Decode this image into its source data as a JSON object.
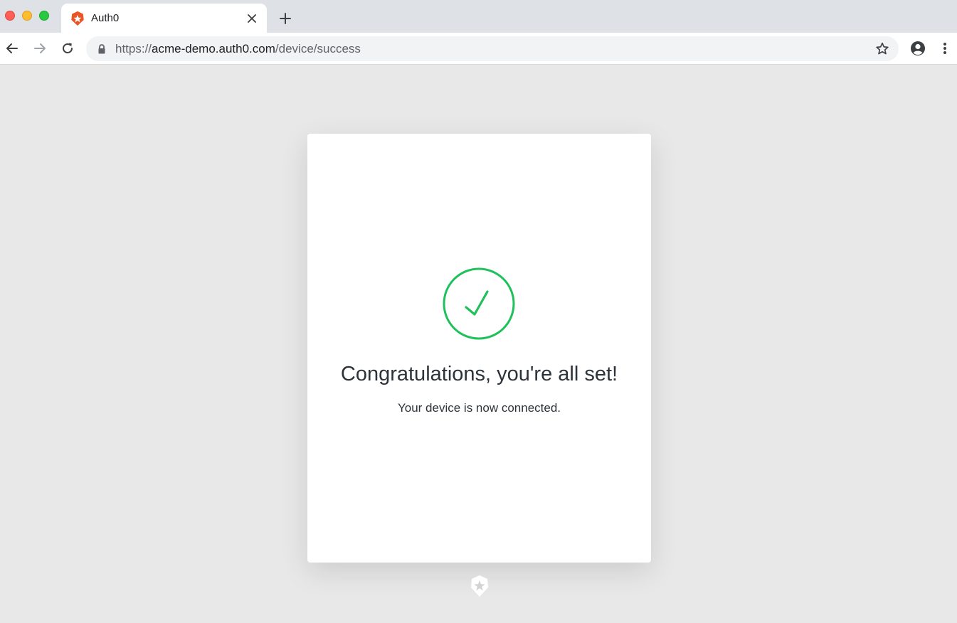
{
  "browser": {
    "tab": {
      "title": "Auth0"
    },
    "address_bar": {
      "url_scheme": "https://",
      "url_host": "acme-demo.auth0.com",
      "url_path": "/device/success"
    }
  },
  "page": {
    "heading": "Congratulations, you're all set!",
    "message": "Your device is now connected."
  },
  "colors": {
    "success_green": "#20c05c",
    "auth0_orange": "#eb5424",
    "text_dark": "#2d333a",
    "page_background": "#e8e8e8"
  },
  "icons": {
    "success": "check-circle-icon",
    "footer": "auth0-logo-icon"
  }
}
